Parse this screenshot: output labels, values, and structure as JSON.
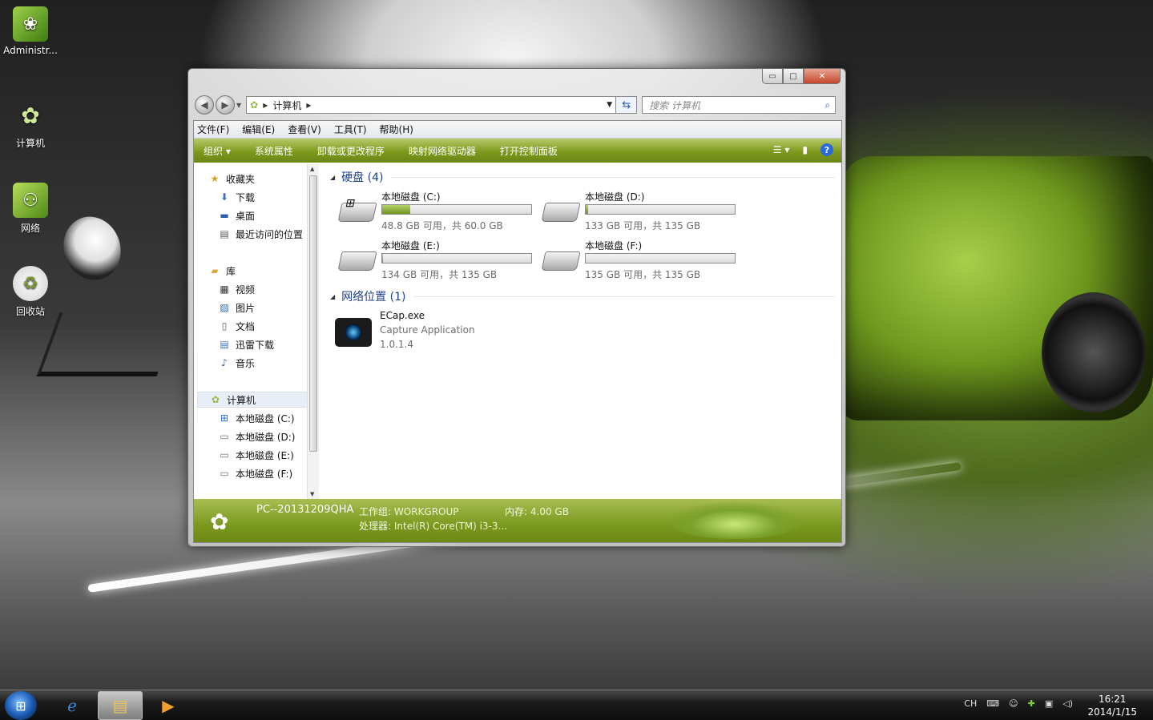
{
  "desktop": {
    "icons": [
      {
        "label": "Administr...",
        "icon": "user-folder-icon"
      },
      {
        "label": "计算机",
        "icon": "computer-lotus-icon"
      },
      {
        "label": "网络",
        "icon": "network-icon"
      },
      {
        "label": "回收站",
        "icon": "recycle-bin-icon"
      }
    ]
  },
  "window": {
    "caption_buttons": {
      "minimize": "▭",
      "maximize": "□",
      "close": "✕"
    },
    "address": {
      "root_icon": "computer-lotus-icon",
      "crumb": "计算机"
    },
    "search": {
      "placeholder": "搜索 计算机"
    },
    "menu": [
      "文件(F)",
      "编辑(E)",
      "查看(V)",
      "工具(T)",
      "帮助(H)"
    ],
    "commands": [
      "组织 ▾",
      "系统属性",
      "卸载或更改程序",
      "映射网络驱动器",
      "打开控制面板"
    ],
    "help_label": "?",
    "nav": {
      "favorites_label": "收藏夹",
      "favorites": [
        "下载",
        "桌面",
        "最近访问的位置"
      ],
      "libraries_label": "库",
      "libraries": [
        "视频",
        "图片",
        "文档",
        "迅雷下载",
        "音乐"
      ],
      "computer_label": "计算机",
      "drives": [
        "本地磁盘 (C:)",
        "本地磁盘 (D:)",
        "本地磁盘 (E:)",
        "本地磁盘 (F:)"
      ]
    },
    "content": {
      "hard_disks_header": "硬盘 (4)",
      "drives": [
        {
          "name": "本地磁盘 (C:)",
          "free": "48.8 GB 可用，共 60.0 GB",
          "used_fraction": 0.187
        },
        {
          "name": "本地磁盘 (D:)",
          "free": "133 GB 可用，共 135 GB",
          "used_fraction": 0.015
        },
        {
          "name": "本地磁盘 (E:)",
          "free": "134 GB 可用，共 135 GB",
          "used_fraction": 0.007
        },
        {
          "name": "本地磁盘 (F:)",
          "free": "135 GB 可用，共 135 GB",
          "used_fraction": 0.0
        }
      ],
      "network_header": "网络位置 (1)",
      "network_item": {
        "name": "ECap.exe",
        "desc": "Capture Application",
        "version": "1.0.1.4"
      }
    },
    "details": {
      "pc_name": "PC--20131209QHA",
      "workgroup_label": "工作组:",
      "workgroup": "WORKGROUP",
      "memory_label": "内存:",
      "memory": "4.00 GB",
      "cpu_label": "处理器:",
      "cpu": "Intel(R) Core(TM) i3-3..."
    }
  },
  "taskbar": {
    "lang": "CH",
    "time": "16:21",
    "date": "2014/1/15"
  }
}
